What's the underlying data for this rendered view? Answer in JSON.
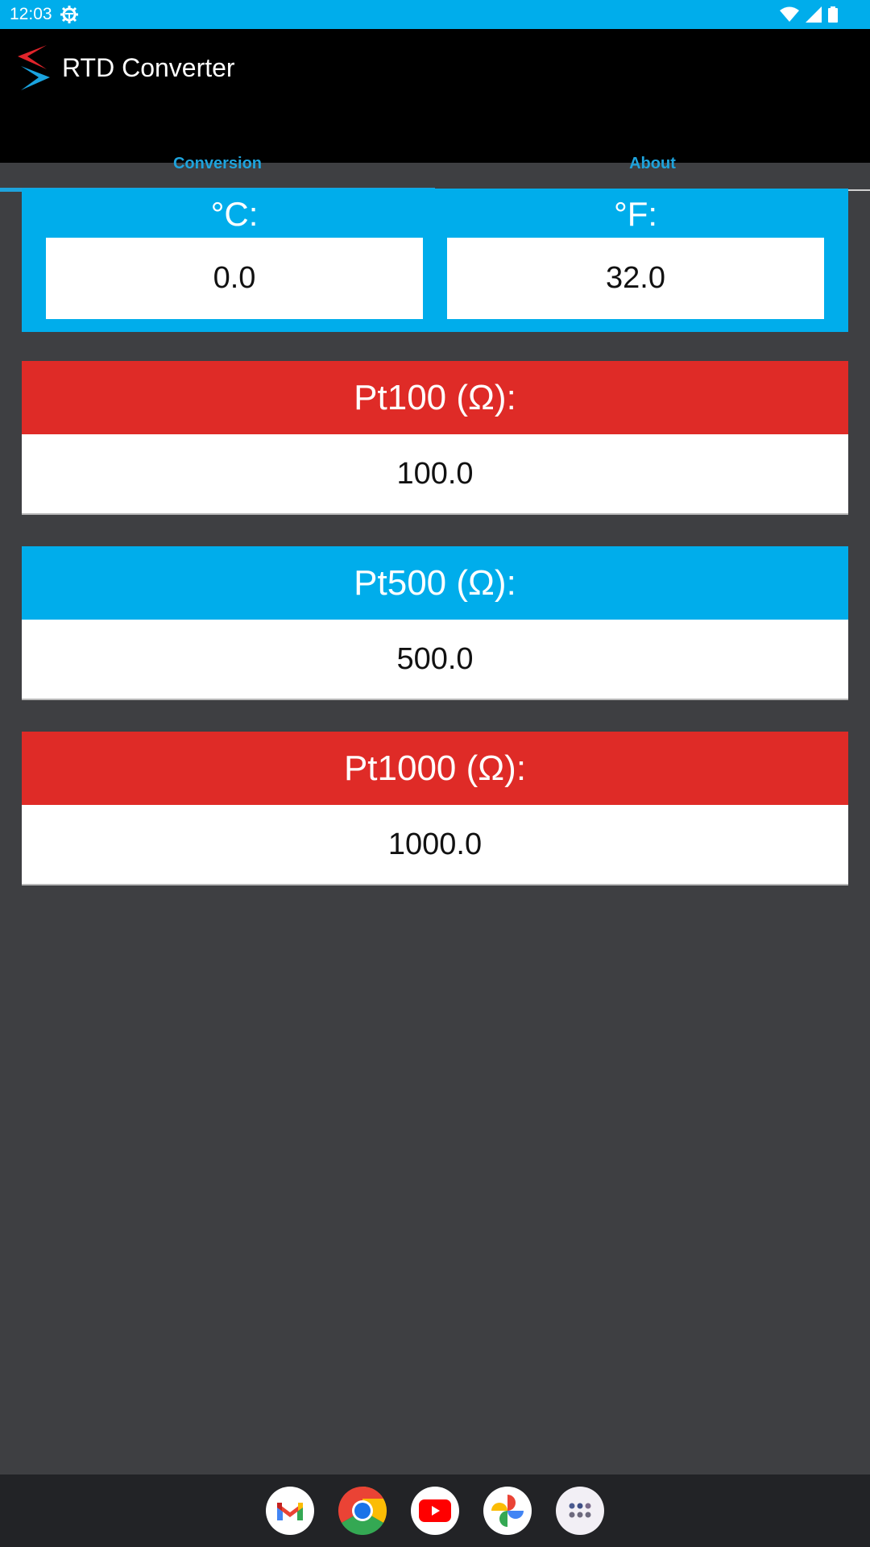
{
  "status_bar": {
    "time": "12:03",
    "icons": [
      "settings-gear-icon",
      "wifi-icon",
      "cellular-signal-icon",
      "battery-icon"
    ]
  },
  "app_bar": {
    "title": "RTD Converter",
    "logo": "rtd-logo-arrows"
  },
  "tabs": [
    {
      "label": "Conversion",
      "active": true
    },
    {
      "label": "About",
      "active": false
    }
  ],
  "temperature": {
    "celsius_label": "°C:",
    "celsius_value": "0.0",
    "fahrenheit_label": "°F:",
    "fahrenheit_value": "32.0"
  },
  "rtd": [
    {
      "label": "Pt100 (Ω):",
      "value": "100.0",
      "color": "#df2b27"
    },
    {
      "label": "Pt500 (Ω):",
      "value": "500.0",
      "color": "#00adeb"
    },
    {
      "label": "Pt1000 (Ω):",
      "value": "1000.0",
      "color": "#df2b27"
    }
  ],
  "dock": [
    {
      "app": "Gmail",
      "icon": "gmail-icon"
    },
    {
      "app": "Chrome",
      "icon": "chrome-icon"
    },
    {
      "app": "YouTube",
      "icon": "youtube-icon"
    },
    {
      "app": "Photos",
      "icon": "photos-icon"
    },
    {
      "app": "App drawer",
      "icon": "apps-grid-icon"
    }
  ],
  "colors": {
    "accent_blue": "#00adeb",
    "accent_red": "#df2b27",
    "tab_text": "#1ea3dc",
    "background": "#3e3f42"
  }
}
